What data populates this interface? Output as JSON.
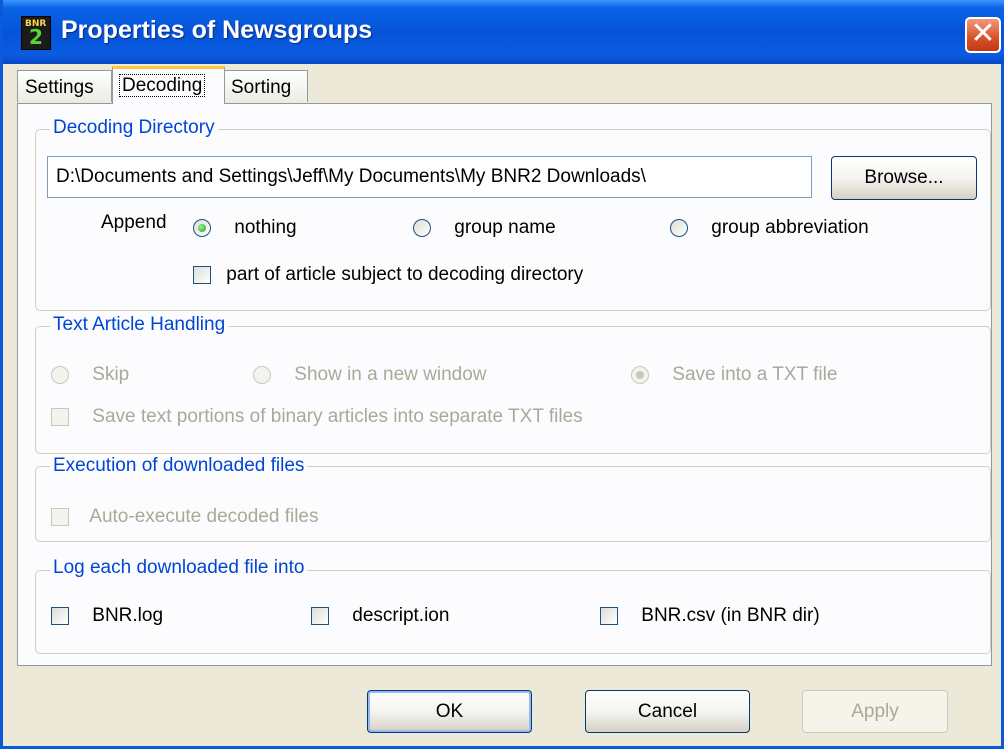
{
  "window": {
    "title": "Properties of Newsgroups",
    "icon_text": {
      "top": "BNR",
      "big": "2"
    },
    "close_symbol": "✕"
  },
  "tabs": [
    {
      "label": "Settings",
      "active": false
    },
    {
      "label": "Decoding",
      "active": true
    },
    {
      "label": "Sorting",
      "active": false
    }
  ],
  "decoding_directory": {
    "legend": "Decoding Directory",
    "path_value": "D:\\Documents and Settings\\Jeff\\My Documents\\My BNR2 Downloads\\",
    "browse_label": "Browse...",
    "append_label": "Append",
    "append_options": [
      {
        "label": "nothing",
        "checked": true
      },
      {
        "label": "group name",
        "checked": false
      },
      {
        "label": "group abbreviation",
        "checked": false
      }
    ],
    "subject_checkbox_label": "part of article subject to decoding directory",
    "subject_checked": false
  },
  "text_article_handling": {
    "legend": "Text Article Handling",
    "options": [
      {
        "label": "Skip",
        "checked": false
      },
      {
        "label": "Show in a new window",
        "checked": false
      },
      {
        "label": "Save into a TXT file",
        "checked": true
      }
    ],
    "separate_txt_label": "Save text portions of binary articles into separate TXT files",
    "disabled": true
  },
  "execution": {
    "legend": "Execution of downloaded files",
    "auto_execute_label": "Auto-execute decoded files",
    "disabled": true
  },
  "log": {
    "legend": "Log each downloaded file into",
    "options": [
      {
        "label": "BNR.log",
        "checked": false
      },
      {
        "label": "descript.ion",
        "checked": false
      },
      {
        "label": "BNR.csv (in BNR dir)",
        "checked": false
      }
    ]
  },
  "buttons": {
    "ok": "OK",
    "cancel": "Cancel",
    "apply": "Apply"
  },
  "colors": {
    "title_bar": "#0553d9",
    "legend_text": "#0046d5",
    "face": "#ece9d8",
    "disabled_text": "#aca899"
  }
}
